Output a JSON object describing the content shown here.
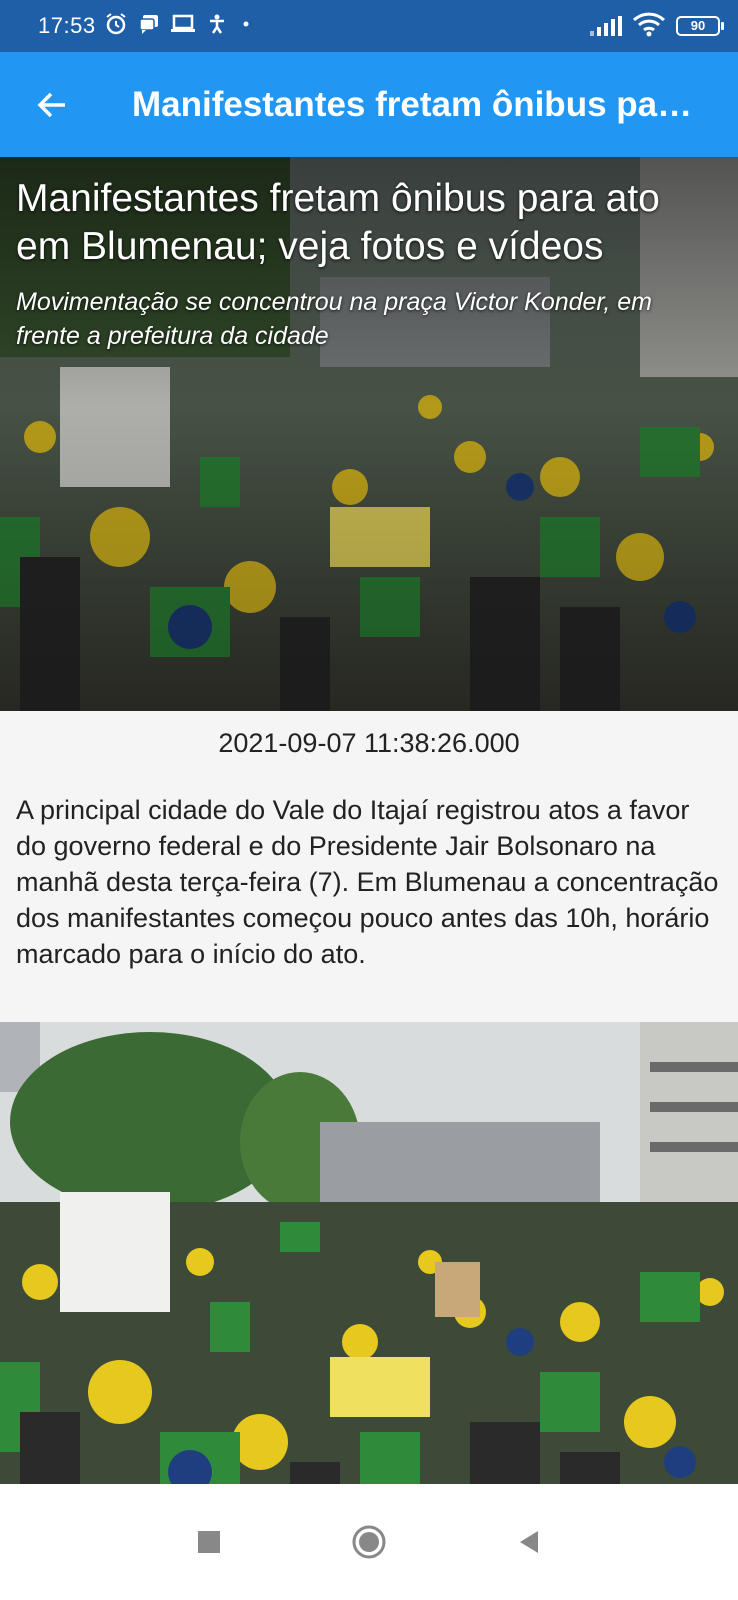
{
  "status_bar": {
    "time": "17:53",
    "battery": "90",
    "icons": [
      "alarm-icon",
      "message-icon",
      "laptop-icon",
      "accessibility-icon",
      "dot-icon",
      "signal-icon",
      "wifi-icon",
      "battery-icon"
    ]
  },
  "app_bar": {
    "back_icon": "arrow-back-icon",
    "title": "Manifestantes fretam ônibus pa…"
  },
  "article": {
    "title": "Manifestantes fretam ônibus para ato em Blumenau; veja fotos e vídeos",
    "subtitle": "Movimentação se concentrou na praça Victor Konder, em frente a prefeitura da cidade",
    "date": "2021-09-07 11:38:26.000",
    "body": "A principal cidade do Vale do Itajaí registrou atos a favor do governo federal e do Presidente Jair Bolsonaro na manhã desta terça-feira (7). Em Blumenau a concentração dos manifestantes começou pouco antes das 10h, horário marcado para o início do ato."
  },
  "nav_bar": {
    "icons": [
      "recents-square-icon",
      "home-circle-icon",
      "back-triangle-icon"
    ]
  },
  "colors": {
    "status_bar": "#1f5fa8",
    "app_bar": "#2196f3",
    "background": "#f5f5f5"
  }
}
